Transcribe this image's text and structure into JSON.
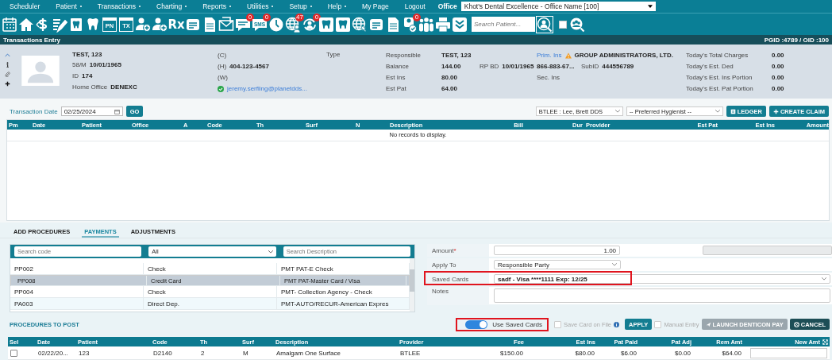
{
  "menu": {
    "items": [
      {
        "label": "Scheduler",
        "has_menu": false
      },
      {
        "label": "Patient",
        "has_menu": true
      },
      {
        "label": "Transactions",
        "has_menu": true
      },
      {
        "label": "Charting",
        "has_menu": true
      },
      {
        "label": "Reports",
        "has_menu": true
      },
      {
        "label": "Utilities",
        "has_menu": true
      },
      {
        "label": "Setup",
        "has_menu": true
      },
      {
        "label": "Help",
        "has_menu": true
      },
      {
        "label": "My Page",
        "has_menu": false
      },
      {
        "label": "Logout",
        "has_menu": false
      }
    ],
    "office_label": "Office",
    "office": "Khot's Dental Excellence - Office Name [100]"
  },
  "toolbar": {
    "icons": [
      {
        "kind": "calendar"
      },
      {
        "kind": "home"
      },
      {
        "kind": "dollar"
      },
      {
        "kind": "pencil-list"
      },
      {
        "kind": "tooth-doc"
      },
      {
        "kind": "tooth"
      },
      {
        "kind": "text-tile",
        "label": "PN"
      },
      {
        "kind": "text-tile",
        "label": "TX"
      },
      {
        "kind": "person-add"
      },
      {
        "kind": "person-add"
      },
      {
        "kind": "text-glyph",
        "label": "Rx"
      },
      {
        "kind": "note"
      },
      {
        "kind": "document"
      },
      {
        "kind": "envelope"
      },
      {
        "kind": "chat",
        "badge": "0"
      },
      {
        "kind": "chat",
        "label": "SMS",
        "badge": "0"
      },
      {
        "kind": "clock"
      },
      {
        "kind": "globe-person",
        "badge": "47"
      },
      {
        "kind": "sync-person",
        "badge": "0"
      },
      {
        "kind": "tooth-tile"
      },
      {
        "kind": "tooth-tile"
      },
      {
        "kind": "globe"
      },
      {
        "kind": "note"
      },
      {
        "kind": "document"
      },
      {
        "kind": "person-check",
        "badge": "0"
      },
      {
        "kind": "people"
      },
      {
        "kind": "printer"
      },
      {
        "kind": "chevron-tile"
      }
    ],
    "search_placeholder": "Search Patient...",
    "filter_checked": false
  },
  "title_bar": {
    "title": "Transactions Entry",
    "ids": "PGID :4789 / OID :100"
  },
  "patient": {
    "name": "TEST, 123",
    "age_sex": "58/M",
    "dob": "10/01/1965",
    "id_label": "ID",
    "id": "174",
    "home_office_label": "Home Office",
    "home_office": "DENEXC",
    "phones": [
      {
        "label": "(C)"
      },
      {
        "label": "(H)",
        "value": "404-123-4567"
      },
      {
        "label": "(W)"
      }
    ],
    "email": "jeremy.serfling@planetdds...",
    "email_verified": true,
    "type_label": "Type"
  },
  "account": [
    {
      "label": "Responsible",
      "value": "TEST, 123"
    },
    {
      "label": "Balance",
      "value": "144.00",
      "extra_label": "RP BD",
      "extra_value": "10/01/1965"
    },
    {
      "label": "Est Ins",
      "value": "80.00"
    },
    {
      "label": "Est Pat",
      "value": "64.00"
    }
  ],
  "insurance": {
    "primary_label": "Prim. Ins",
    "warning": true,
    "carrier": "GROUP ADMINISTRATORS, LTD.",
    "phone": "866-883-67...",
    "subid_label": "SubID",
    "subid": "444556789",
    "secondary_label": "Sec. Ins"
  },
  "totals": [
    {
      "label": "Today's Total Charges",
      "value": "0.00"
    },
    {
      "label": "Today's Est. Ded",
      "value": "0.00"
    },
    {
      "label": "Today's Est. Ins Portion",
      "value": "0.00"
    },
    {
      "label": "Today's Est. Pat Portion",
      "value": "0.00"
    }
  ],
  "transaction": {
    "date_label": "Transaction Date",
    "date": "02/25/2024",
    "go": "GO",
    "provider": "BTLEE : Lee, Brett DDS",
    "hygienist": "-- Preferred Hygienist --",
    "ledger": "LEDGER",
    "create_claim": "CREATE CLAIM"
  },
  "transactions_table": {
    "columns": [
      "Pm",
      "Date",
      "Patient",
      "Office",
      "A",
      "Code",
      "Th",
      "Surf",
      "N",
      "Description",
      "Bill",
      "Dur",
      "Provider",
      "Est Pat",
      "Est Ins",
      "Amount"
    ],
    "empty_text": "No records to display."
  },
  "tabs": [
    {
      "label": "ADD PROCEDURES",
      "selected": false
    },
    {
      "label": "PAYMENTS",
      "selected": true
    },
    {
      "label": "ADJUSTMENTS",
      "selected": false
    }
  ],
  "code_list": {
    "code_placeholder": "Search code",
    "type_filter": "All",
    "description_placeholder": "Search Description",
    "rows": [
      {
        "code": "PP002",
        "type": "Check",
        "description": "PMT PAT-E Check",
        "selected": false
      },
      {
        "code": "PP008",
        "type": "Credit Card",
        "description": "PMT PAT-Master Card / Visa",
        "selected": true
      },
      {
        "code": "PP004",
        "type": "Check",
        "description": "PMT- Collection Agency - Check",
        "selected": false
      },
      {
        "code": "PA003",
        "type": "Direct Dep.",
        "description": "PMT-AUTO/RECUR-American Expres",
        "selected": false
      }
    ]
  },
  "payment_form": {
    "amount_label": "Amount",
    "amount_required_mark": "*",
    "amount": "1.00",
    "apply_to_label": "Apply To",
    "apply_to": "Responsible Party",
    "saved_cards_label": "Saved Cards",
    "saved_card": "sadf - Visa ****1111 Exp: 12/25",
    "saved_cards_highlighted": true,
    "notes_label": "Notes"
  },
  "procedures": {
    "title": "PROCEDURES TO POST",
    "use_saved_cards": {
      "label": "Use Saved Cards",
      "on": true,
      "highlighted": true
    },
    "save_card": {
      "label": "Save Card on File",
      "checked": false,
      "disabled": true
    },
    "apply": "APPLY",
    "manual_entry": {
      "label": "Manual Entry",
      "checked": false,
      "disabled": true
    },
    "launch_pay": {
      "label": "LAUNCH DENTICON PAY",
      "disabled": true
    },
    "cancel": "CANCEL",
    "columns": [
      "Sel",
      "Date",
      "Patient",
      "Code",
      "Th",
      "Surf",
      "Description",
      "Provider",
      "Fee",
      "Est Ins",
      "Pat Paid",
      "Pat Adj",
      "Rem Amt",
      "New Amt"
    ],
    "rows": [
      {
        "selected": false,
        "cells": [
          "",
          "02/22/20...",
          "123",
          "D2140",
          "2",
          "M",
          "Amalgam One Surface",
          "BTLEE",
          "$150.00",
          "$80.00",
          "$6.00",
          "$0.00",
          "$64.00",
          ""
        ]
      }
    ]
  }
}
